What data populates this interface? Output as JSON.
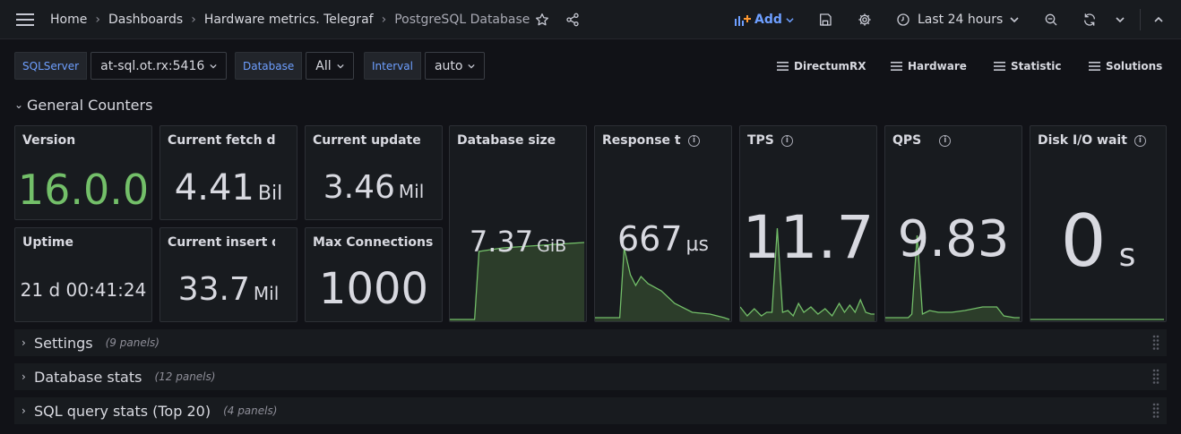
{
  "breadcrumb": {
    "items": [
      "Home",
      "Dashboards",
      "Hardware metrics. Telegraf",
      "PostgreSQL Database"
    ]
  },
  "toolbar": {
    "add_label": "Add",
    "time_range": "Last 24 hours",
    "icons": [
      "star-icon",
      "share-icon",
      "save-icon",
      "gear-icon",
      "clock-icon",
      "zoom-out-icon",
      "refresh-icon",
      "chevron-down-icon",
      "chevron-up-icon"
    ]
  },
  "variables": [
    {
      "label": "SQLServer",
      "value": "at-sql.ot.rx:5416"
    },
    {
      "label": "Database",
      "value": "All"
    },
    {
      "label": "Interval",
      "value": "auto"
    }
  ],
  "dashboard_links": [
    "DirectumRX",
    "Hardware",
    "Statistic",
    "Solutions"
  ],
  "rows": {
    "general": {
      "title": "General Counters"
    },
    "collapsed": [
      {
        "title": "Settings",
        "count": "(9 panels)"
      },
      {
        "title": "Database stats",
        "count": "(12 panels)"
      },
      {
        "title": "SQL query stats (Top 20)",
        "count": "(4 panels)"
      }
    ]
  },
  "panels": {
    "version": {
      "title": "Version",
      "value": "16.0.0",
      "color": "#73bf69"
    },
    "fetch": {
      "title": "Current fetch data",
      "value": "4.41",
      "unit": "Bil"
    },
    "update": {
      "title": "Current update data",
      "value": "3.46",
      "unit": "Mil"
    },
    "uptime": {
      "title": "Uptime",
      "value": "21 d 00:41:24"
    },
    "insert": {
      "title": "Current insert data",
      "value": "33.7",
      "unit": "Mil"
    },
    "maxconn": {
      "title": "Max Connections",
      "value": "1000"
    },
    "dbsize": {
      "title": "Database size",
      "value": "7.37",
      "unit": "GiB"
    },
    "response": {
      "title": "Response time",
      "value": "667",
      "unit": "µs"
    },
    "tps": {
      "title": "TPS",
      "value": "11.7"
    },
    "qps": {
      "title": "QPS",
      "value": "9.83"
    },
    "diskio": {
      "title": "Disk I/O wait",
      "value": "0",
      "unit": "s"
    }
  },
  "colors": {
    "accent": "#6e9fff",
    "spark_line": "#73bf69",
    "spark_fill": "#2c3d2a"
  }
}
